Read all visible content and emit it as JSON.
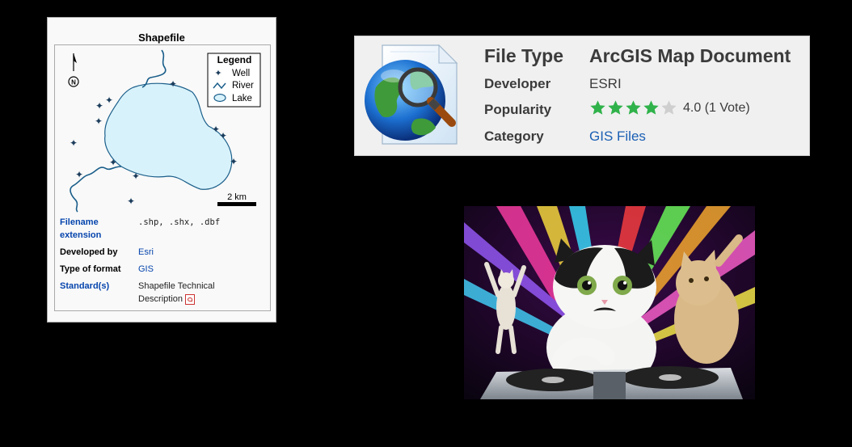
{
  "shapefile_infobox": {
    "title": "Shapefile",
    "map": {
      "legend_title": "Legend",
      "legend_items": [
        {
          "icon": "well-icon",
          "label": "Well"
        },
        {
          "icon": "river-icon",
          "label": "River"
        },
        {
          "icon": "lake-icon",
          "label": "Lake"
        }
      ],
      "north_letter": "N",
      "scale_label": "2 km"
    },
    "rows": [
      {
        "key": "Filename extension",
        "value": ".shp, .shx, .dbf"
      },
      {
        "key": "Developed by",
        "value": "Esri"
      },
      {
        "key": "Type of format",
        "value": "GIS"
      },
      {
        "key": "Standard(s)",
        "value": "Shapefile Technical Description"
      }
    ],
    "colors": {
      "link": "#0645ad",
      "lake_fill": "#d8f2fb",
      "river": "#1a5e8a",
      "well": "#1c3d5c"
    }
  },
  "file_type_card": {
    "icon": "arcgis-map-document-icon",
    "rows": {
      "file_type": {
        "label": "File Type",
        "value": "ArcGIS Map Document"
      },
      "developer": {
        "label": "Developer",
        "value": "ESRI"
      },
      "popularity": {
        "label": "Popularity",
        "rating": 4.0,
        "max": 5,
        "rating_text": "4.0 (1 Vote)"
      },
      "category": {
        "label": "Category",
        "value": "GIS Files"
      }
    },
    "colors": {
      "star_on": "#2fb24a",
      "star_off": "#cfcfcf",
      "link": "#1a5fb4"
    }
  },
  "dj_cat_image": {
    "icon": "dj-cat-photo"
  }
}
